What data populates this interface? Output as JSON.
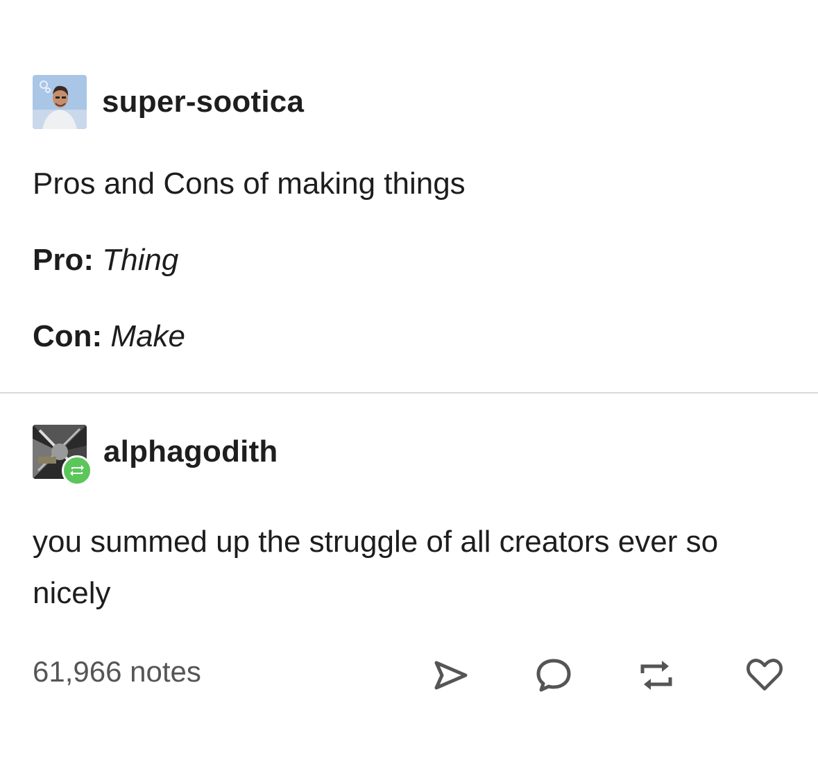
{
  "original_post": {
    "username": "super-sootica",
    "title": "Pros and Cons of making things",
    "pro_label": "Pro:",
    "pro_value": "Thing",
    "con_label": "Con:",
    "con_value": "Make"
  },
  "reblog": {
    "username": "alphagodith",
    "text": "you summed up the struggle of all creators ever so nicely"
  },
  "footer": {
    "notes": "61,966 notes",
    "icons": [
      "share-icon",
      "reply-icon",
      "reblog-icon",
      "heart-icon"
    ]
  },
  "colors": {
    "reblog_badge": "#5bc65a",
    "divider": "#d9d9d9",
    "notes_text": "#555555"
  }
}
